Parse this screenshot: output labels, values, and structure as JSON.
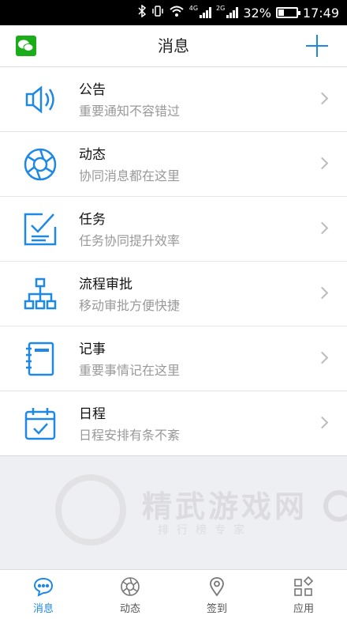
{
  "status_bar": {
    "battery": "32%",
    "time": "17:49",
    "net1": "4G",
    "net2": "2G",
    "battery_level": 0.32
  },
  "header": {
    "title": "消息",
    "colors": {
      "accent": "#1e88e5",
      "wechat": "#1aad19"
    }
  },
  "items": [
    {
      "title": "公告",
      "subtitle": "重要通知不容错过",
      "icon": "speaker-icon"
    },
    {
      "title": "动态",
      "subtitle": "协同消息都在这里",
      "icon": "aperture-icon"
    },
    {
      "title": "任务",
      "subtitle": "任务协同提升效率",
      "icon": "task-check-icon"
    },
    {
      "title": "流程审批",
      "subtitle": "移动审批方便快捷",
      "icon": "flowchart-icon"
    },
    {
      "title": "记事",
      "subtitle": "重要事情记在这里",
      "icon": "notebook-icon"
    },
    {
      "title": "日程",
      "subtitle": "日程安排有条不紊",
      "icon": "calendar-icon"
    }
  ],
  "watermark": {
    "name": "精武游戏网",
    "sub": "排行榜专家"
  },
  "tabs": [
    {
      "label": "消息",
      "icon": "chat-bubble-icon",
      "active": true
    },
    {
      "label": "动态",
      "icon": "aperture-icon"
    },
    {
      "label": "签到",
      "icon": "location-pin-icon"
    },
    {
      "label": "应用",
      "icon": "apps-grid-icon"
    }
  ]
}
